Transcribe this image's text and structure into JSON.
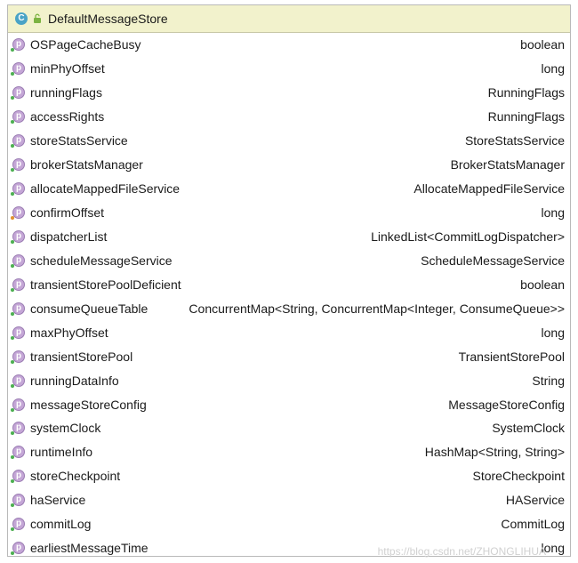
{
  "header": {
    "title": "DefaultMessageStore",
    "class_badge": "C",
    "class_icon": "class-icon",
    "lock_icon": "unlock-icon"
  },
  "field_badge": "p",
  "fields": [
    {
      "name": "OSPageCacheBusy",
      "type": "boolean",
      "access": "green"
    },
    {
      "name": "minPhyOffset",
      "type": "long",
      "access": "green"
    },
    {
      "name": "runningFlags",
      "type": "RunningFlags",
      "access": "green"
    },
    {
      "name": "accessRights",
      "type": "RunningFlags",
      "access": "green"
    },
    {
      "name": "storeStatsService",
      "type": "StoreStatsService",
      "access": "green"
    },
    {
      "name": "brokerStatsManager",
      "type": "BrokerStatsManager",
      "access": "green"
    },
    {
      "name": "allocateMappedFileService",
      "type": "AllocateMappedFileService",
      "access": "green"
    },
    {
      "name": "confirmOffset",
      "type": "long",
      "access": "orange"
    },
    {
      "name": "dispatcherList",
      "type": "LinkedList<CommitLogDispatcher>",
      "access": "green"
    },
    {
      "name": "scheduleMessageService",
      "type": "ScheduleMessageService",
      "access": "green"
    },
    {
      "name": "transientStorePoolDeficient",
      "type": "boolean",
      "access": "green"
    },
    {
      "name": "consumeQueueTable",
      "type": "ConcurrentMap<String, ConcurrentMap<Integer, ConsumeQueue>>",
      "access": "green"
    },
    {
      "name": "maxPhyOffset",
      "type": "long",
      "access": "green"
    },
    {
      "name": "transientStorePool",
      "type": "TransientStorePool",
      "access": "green"
    },
    {
      "name": "runningDataInfo",
      "type": "String",
      "access": "green"
    },
    {
      "name": "messageStoreConfig",
      "type": "MessageStoreConfig",
      "access": "green"
    },
    {
      "name": "systemClock",
      "type": "SystemClock",
      "access": "green"
    },
    {
      "name": "runtimeInfo",
      "type": "HashMap<String, String>",
      "access": "green"
    },
    {
      "name": "storeCheckpoint",
      "type": "StoreCheckpoint",
      "access": "green"
    },
    {
      "name": "haService",
      "type": "HAService",
      "access": "green"
    },
    {
      "name": "commitLog",
      "type": "CommitLog",
      "access": "green"
    },
    {
      "name": "earliestMessageTime",
      "type": "long",
      "access": "green"
    }
  ],
  "watermark": "https://blog.csdn.net/ZHONGLIHUA"
}
